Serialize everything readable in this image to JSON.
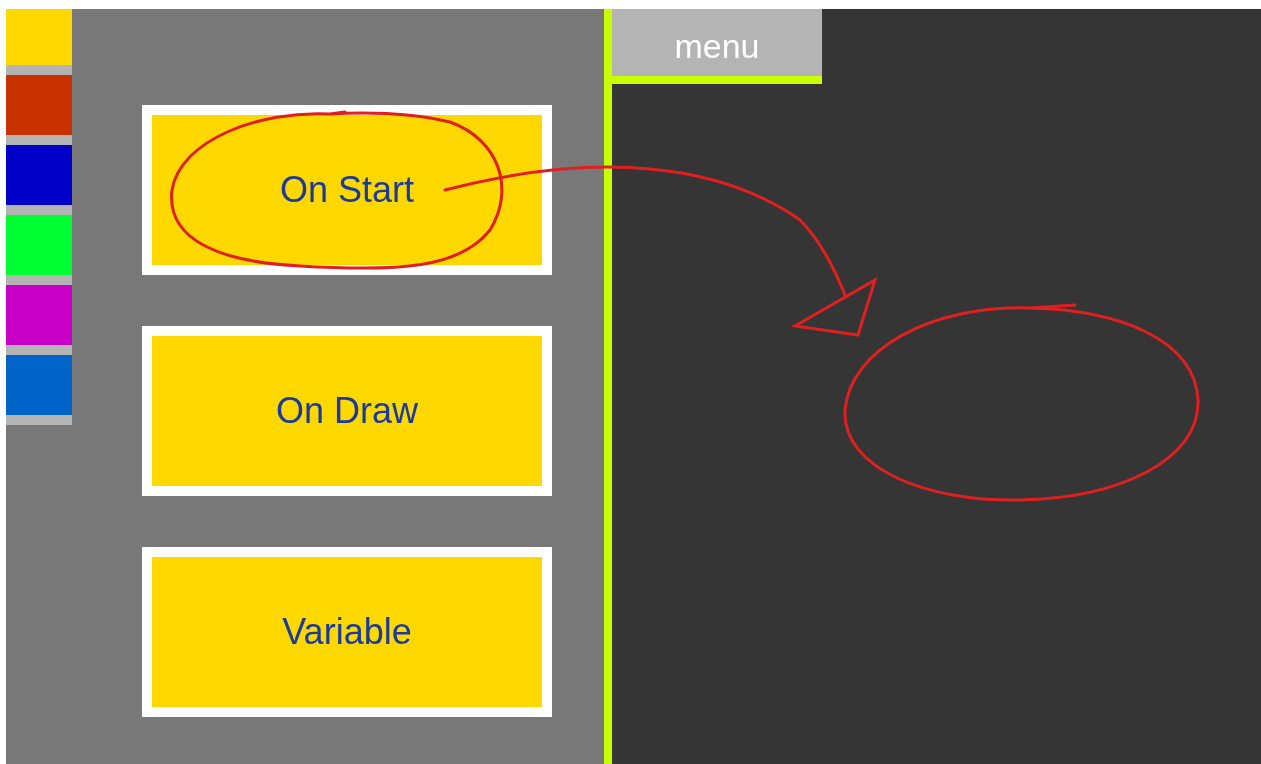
{
  "palette": [
    {
      "color": "#ffd800"
    },
    {
      "color": "#c83200"
    },
    {
      "color": "#0000c8"
    },
    {
      "color": "#00ff32"
    },
    {
      "color": "#c800c8"
    },
    {
      "color": "#0064c8"
    }
  ],
  "blocks": [
    {
      "label": "On Start"
    },
    {
      "label": "On Draw"
    },
    {
      "label": "Variable"
    }
  ],
  "menu": {
    "label": "menu"
  }
}
